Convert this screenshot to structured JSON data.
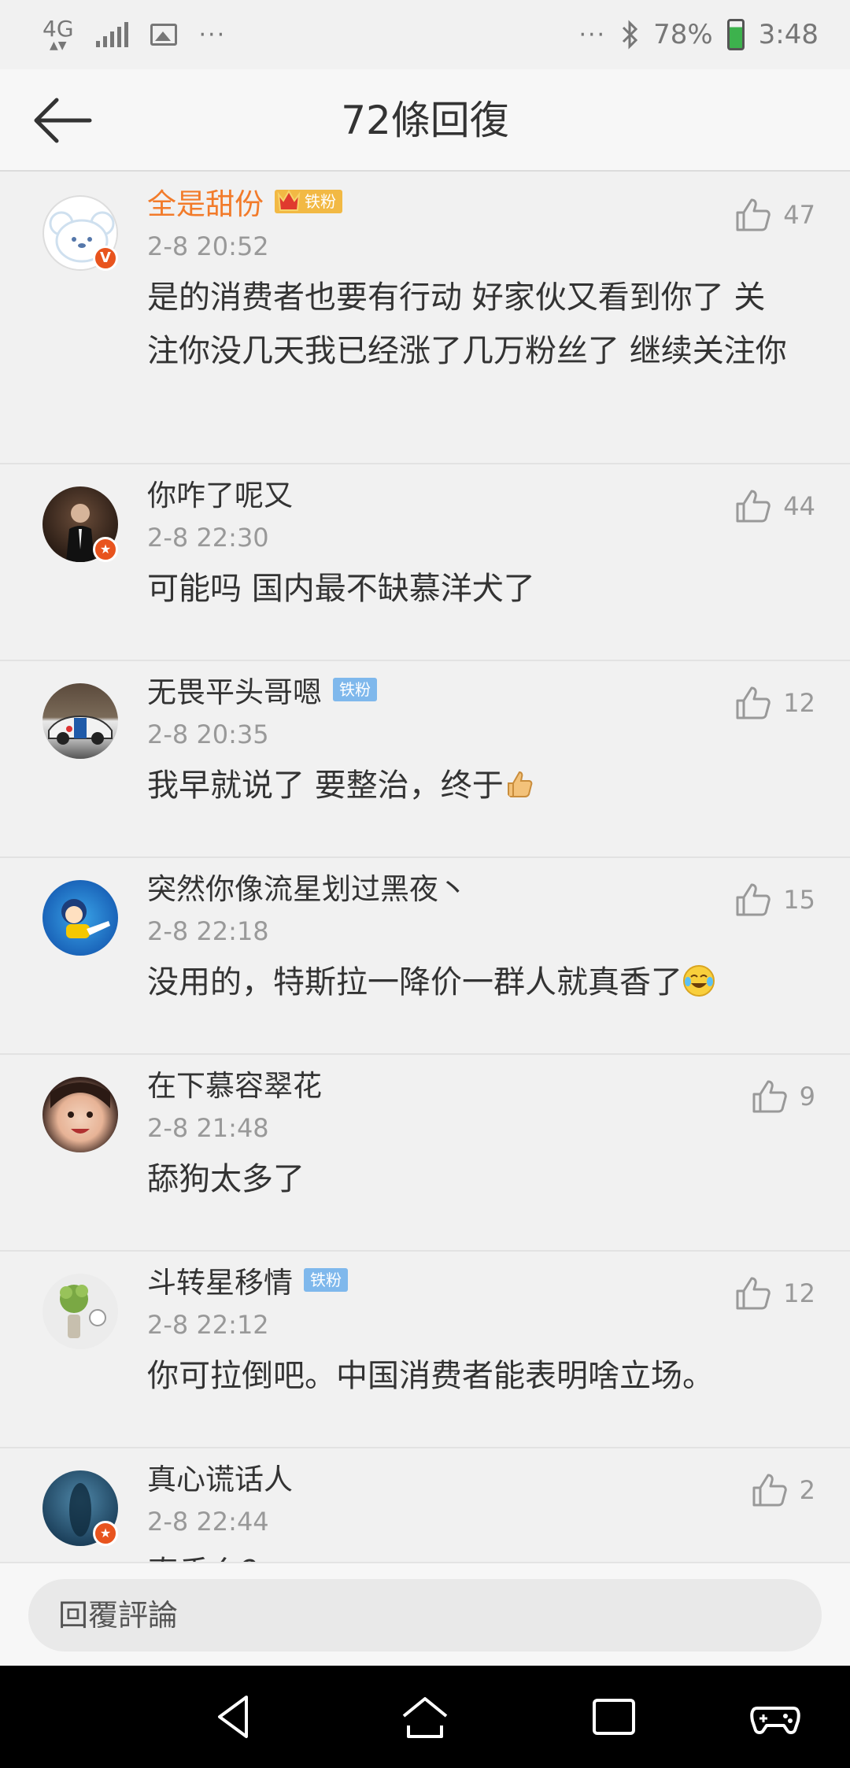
{
  "status_bar": {
    "network": "4G",
    "dots_left": "···",
    "dots_right": "···",
    "battery": "78%",
    "time": "3:48"
  },
  "header": {
    "title": "72條回復"
  },
  "comments": [
    {
      "username": "全是甜份",
      "badge": "铁粉",
      "badge_type": "gold",
      "timestamp": "2-8 20:52",
      "content": "是的消费者也要有行动 好家伙又看到你了 关注你没几天我已经涨了几万粉丝了 继续关注你",
      "likes": "47",
      "verified": "V"
    },
    {
      "username": "你咋了呢又",
      "badge": "",
      "timestamp": "2-8 22:30",
      "content": "可能吗 国内最不缺慕洋犬了",
      "likes": "44"
    },
    {
      "username": "无畏平头哥嗯",
      "badge": "铁粉",
      "badge_type": "blue",
      "timestamp": "2-8 20:35",
      "content": "我早就说了 要整治，终于",
      "emoji": "thumbs-up-emoji",
      "likes": "12"
    },
    {
      "username": "突然你像流星划过黑夜丶",
      "badge": "",
      "timestamp": "2-8 22:18",
      "content": "没用的，特斯拉一降价一群人就真香了",
      "emoji": "laughing-crying-emoji",
      "likes": "15"
    },
    {
      "username": "在下慕容翠花",
      "badge": "",
      "timestamp": "2-8 21:48",
      "content": "舔狗太多了",
      "likes": "9"
    },
    {
      "username": "斗转星移情",
      "badge": "铁粉",
      "badge_type": "blue",
      "timestamp": "2-8 22:12",
      "content": "你可拉倒吧。中国消费者能表明啥立场。",
      "likes": "12"
    },
    {
      "username": "真心谎话人",
      "badge": "",
      "timestamp": "2-8 22:44",
      "content": "真香么？",
      "likes": "2"
    }
  ],
  "reply_bar": {
    "placeholder": "回覆評論"
  },
  "colors": {
    "accent_orange": "#f27b2a",
    "fan_blue": "#7fb8ec",
    "fan_gold": "#f2b944",
    "verified_red": "#e8541e"
  }
}
